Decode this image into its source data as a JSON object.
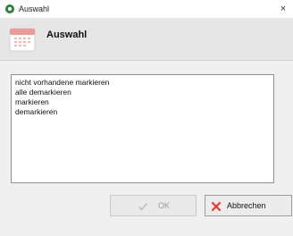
{
  "window": {
    "title": "Auswahl",
    "close_symbol": "×"
  },
  "header": {
    "title": "Auswahl"
  },
  "list": {
    "items": [
      "nicht vorhandene markieren",
      "alle demarkieren",
      "markieren",
      "demarkieren"
    ]
  },
  "buttons": {
    "ok_label": "OK",
    "cancel_label": "Abbrechen"
  },
  "icons": {
    "app": "app-logo-icon",
    "header": "calendar-icon",
    "ok": "checkmark-icon",
    "cancel": "red-x-icon"
  },
  "colors": {
    "app_icon": "#2e7d32",
    "calendar_accent": "#e57373",
    "cancel_x": "#e53935",
    "ok_check": "#b8b8b8"
  }
}
